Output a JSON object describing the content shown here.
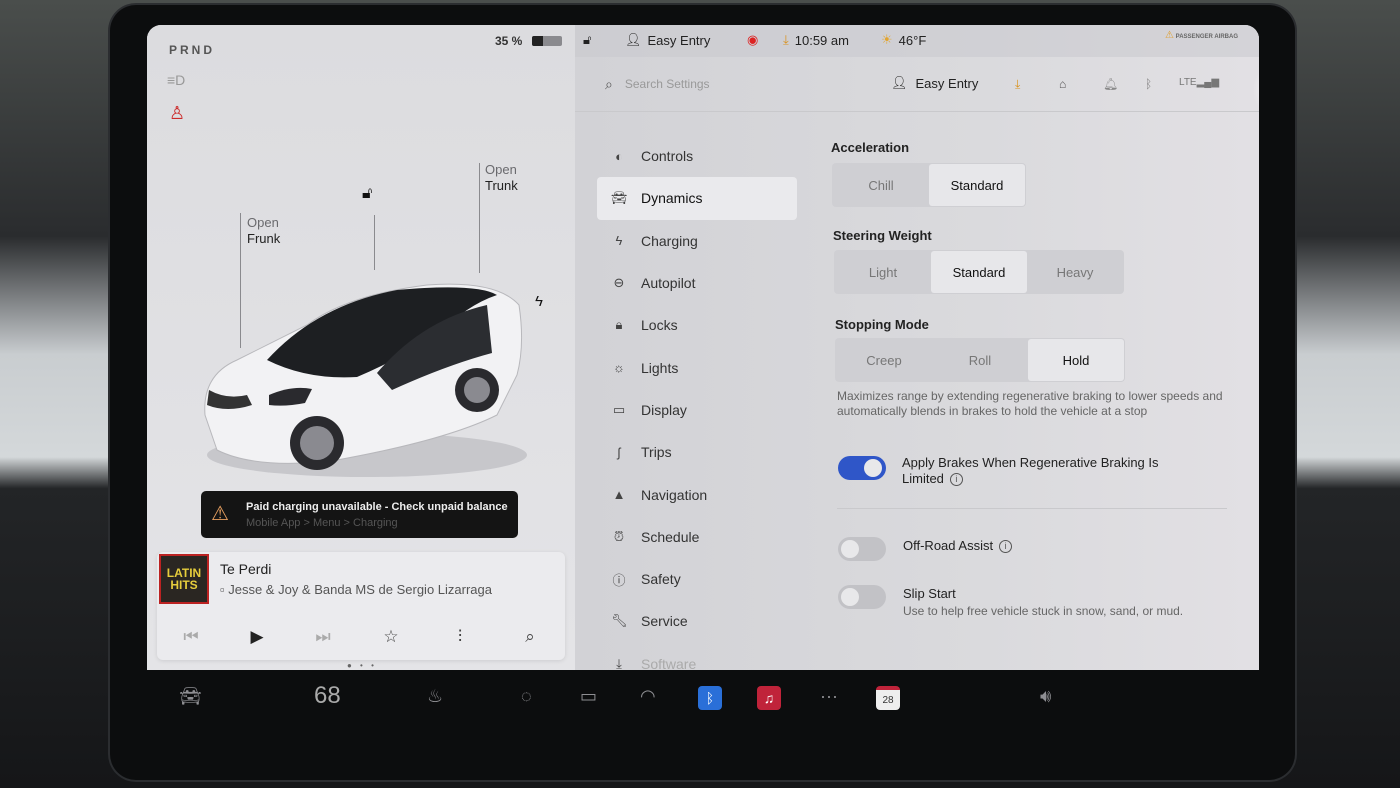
{
  "status": {
    "gear": "PRND",
    "battery_percent": "35 %",
    "battery_level": 0.35,
    "lock_state": "unlocked",
    "profile": "Easy Entry",
    "time": "10:59 am",
    "temperature": "46°F",
    "airbag": "PASSENGER AIRBAG"
  },
  "car_view": {
    "frunk": {
      "line1": "Open",
      "line2": "Frunk"
    },
    "trunk": {
      "line1": "Open",
      "line2": "Trunk"
    }
  },
  "alert": {
    "title": "Paid charging unavailable - Check unpaid balance",
    "subtitle": "Mobile App > Menu > Charging"
  },
  "media": {
    "album_line1": "LATIN",
    "album_line2": "HITS",
    "title": "Te Perdi",
    "artist": "Jesse & Joy & Banda MS de Sergio Lizarraga"
  },
  "settings": {
    "search_placeholder": "Search Settings",
    "profile": "Easy Entry",
    "nav": [
      {
        "label": "Controls",
        "icon": "toggle-icon"
      },
      {
        "label": "Dynamics",
        "icon": "car-icon",
        "active": true
      },
      {
        "label": "Charging",
        "icon": "bolt-icon"
      },
      {
        "label": "Autopilot",
        "icon": "steering-wheel-icon"
      },
      {
        "label": "Locks",
        "icon": "lock-icon"
      },
      {
        "label": "Lights",
        "icon": "sun-icon"
      },
      {
        "label": "Display",
        "icon": "display-icon"
      },
      {
        "label": "Trips",
        "icon": "trips-icon"
      },
      {
        "label": "Navigation",
        "icon": "navigation-icon"
      },
      {
        "label": "Schedule",
        "icon": "alarm-icon"
      },
      {
        "label": "Safety",
        "icon": "alert-circle-icon"
      },
      {
        "label": "Service",
        "icon": "wrench-icon"
      },
      {
        "label": "Software",
        "icon": "download-icon"
      }
    ],
    "acceleration": {
      "title": "Acceleration",
      "options": [
        "Chill",
        "Standard"
      ],
      "selected": "Standard"
    },
    "steering": {
      "title": "Steering Weight",
      "options": [
        "Light",
        "Standard",
        "Heavy"
      ],
      "selected": "Standard"
    },
    "stopping": {
      "title": "Stopping Mode",
      "options": [
        "Creep",
        "Roll",
        "Hold"
      ],
      "selected": "Hold",
      "description": "Maximizes range by extending regenerative braking to lower speeds and automatically blends in brakes to hold the vehicle at a stop"
    },
    "apply_brakes": {
      "label": "Apply Brakes When Regenerative Braking Is Limited",
      "on": true
    },
    "off_road": {
      "label": "Off-Road Assist",
      "on": false
    },
    "slip_start": {
      "label": "Slip Start",
      "sub": "Use to help free vehicle stuck in snow, sand, or mud.",
      "on": false
    }
  },
  "dock": {
    "cabin_temp": "68",
    "calendar_day": "28"
  }
}
